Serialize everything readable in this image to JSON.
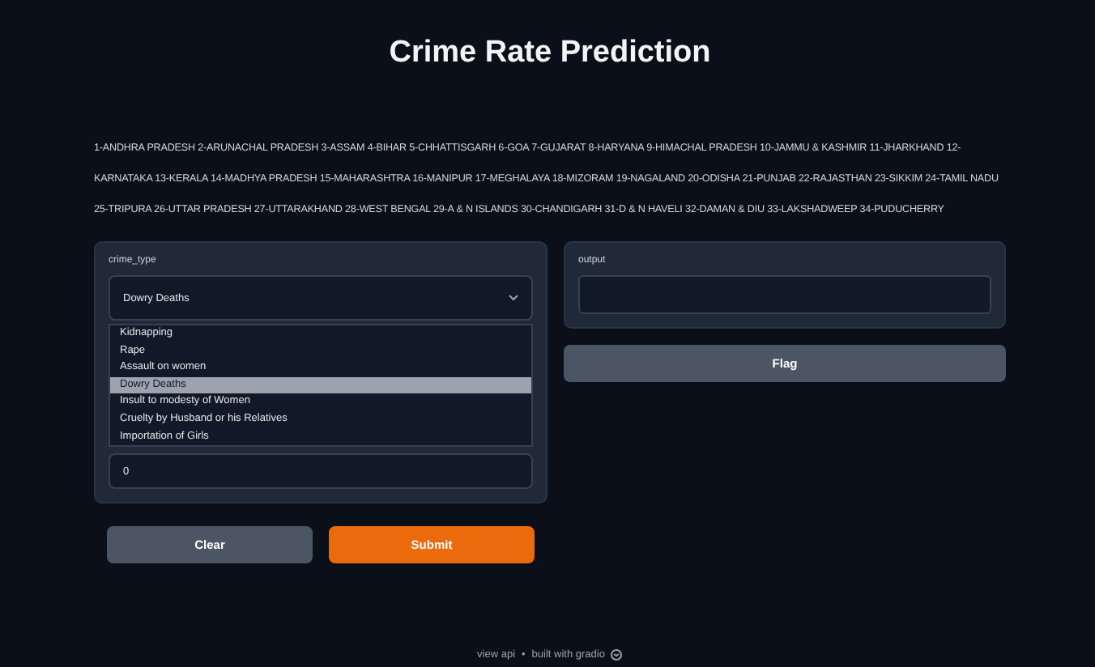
{
  "title": "Crime Rate Prediction",
  "states_legend": "1-ANDHRA PRADESH 2-ARUNACHAL PRADESH 3-ASSAM 4-BIHAR 5-CHHATTISGARH 6-GOA 7-GUJARAT 8-HARYANA 9-HIMACHAL PRADESH 10-JAMMU & KASHMIR 11-JHARKHAND 12-KARNATAKA 13-KERALA 14-MADHYA PRADESH 15-MAHARASHTRA 16-MANIPUR 17-MEGHALAYA 18-MIZORAM 19-NAGALAND 20-ODISHA 21-PUNJAB 22-RAJASTHAN 23-SIKKIM 24-TAMIL NADU 25-TRIPURA 26-UTTAR PRADESH 27-UTTARAKHAND 28-WEST BENGAL 29-A & N ISLANDS 30-CHANDIGARH 31-D & N HAVELI 32-DAMAN & DIU 33-LAKSHADWEEP 34-PUDUCHERRY",
  "crime_type": {
    "label": "crime_type",
    "value": "Dowry Deaths",
    "options": [
      {
        "label": "Kidnapping",
        "selected": false
      },
      {
        "label": "Rape",
        "selected": false
      },
      {
        "label": "Assault on women",
        "selected": false
      },
      {
        "label": "Dowry Deaths",
        "selected": true
      },
      {
        "label": "Insult to modesty of Women",
        "selected": false
      },
      {
        "label": "Cruelty by Husband or his Relatives",
        "selected": false
      },
      {
        "label": "Importation of Girls",
        "selected": false
      }
    ]
  },
  "number_field": {
    "value": "0"
  },
  "buttons": [
    {
      "label": "Clear",
      "kind": "secondary"
    },
    {
      "label": "Submit",
      "kind": "primary"
    }
  ],
  "output": {
    "label": "output"
  },
  "flag_button": {
    "label": "Flag"
  },
  "footer": {
    "api_link": "view api",
    "separator": "•",
    "built_with": "built with gradio"
  }
}
